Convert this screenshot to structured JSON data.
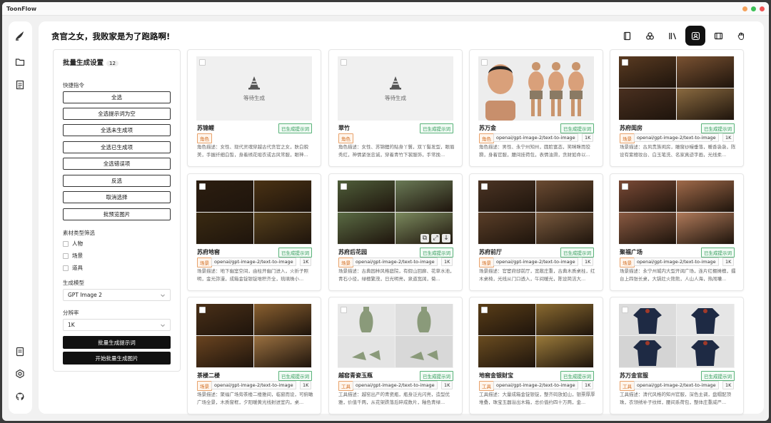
{
  "app": {
    "title": "ToonFlow"
  },
  "page": {
    "title": "贪官之女，我败家是为了跑路啊!"
  },
  "panel": {
    "title": "批量生成设置",
    "count": "12",
    "quick_label": "快捷指令",
    "quick_buttons": [
      "全选",
      "全选提示词为空",
      "全选未生成项",
      "全选已生成项",
      "全选错误项",
      "反选",
      "取消选择",
      "批预览图片"
    ],
    "filter_label": "素材类型筛选",
    "filters": [
      "人物",
      "场景",
      "道具"
    ],
    "model_label": "生成模型",
    "model_value": "GPT Image 2",
    "resolution_label": "分辨率",
    "resolution_value": "1K",
    "batch_prompt_btn": "批量生成提示词",
    "batch_image_btn": "开始批量生成图片"
  },
  "cards": [
    {
      "name": "苏锦鲤",
      "status": "已生成提示词",
      "type": "角色",
      "model": "",
      "size": "",
      "desc": "角色描述：女性、现代灵魂穿越古代贪官之女，肤白貌美，手握纤细白皙，身着绣花缎衣或古风常服，眼神...",
      "waiting": "等待生成"
    },
    {
      "name": "翠竹",
      "status": "已生成提示词",
      "type": "角色",
      "model": "",
      "size": "",
      "desc": "角色描述：女性、苏锦鲤的贴身丫鬟，双丫髻发型，眼眉秀红，神情紧张忠诚，穿着青竹下裳服饰，手常挽...",
      "waiting": "等待生成"
    },
    {
      "name": "苏万金",
      "status": "已生成提示词",
      "type": "角色",
      "model": "openai/gpt-image-2/text-to-image",
      "size": "1K",
      "desc": "角色描述：男性、永宁州知州，圆脸富态，笑眯眯而狡猾，身着官服，腰间挂荷包，表情油滑，贪财如命以...",
      "waiting": ""
    },
    {
      "name": "苏府闺房",
      "status": "已生成提示词",
      "type": "场景",
      "model": "openai/gpt-image-2/text-to-image",
      "size": "1K",
      "desc": "场景描述：古风贵族闺房，雕窗纱幔垂落，暖香袅袅，陈设有紫檀妆台、白玉笔洗、名家真迹字画，光线柔...",
      "waiting": ""
    },
    {
      "name": "苏府地窖",
      "status": "已生成提示词",
      "type": "场景",
      "model": "openai/gpt-image-2/text-to-image",
      "size": "1K",
      "desc": "场景描述：地下幽室空间，由柱开幽门进入，火折子照明，金光弥漫，成箱金锭银锭堆积齐全，琉璃珠小...",
      "waiting": ""
    },
    {
      "name": "苏府后花园",
      "status": "已生成提示词",
      "type": "场景",
      "model": "openai/gpt-image-2/text-to-image",
      "size": "1K",
      "desc": "场景描述：古典园林风格庭院，有假山回廊、花草水池，青石小径，绿檀繁茂，日光明亮，泉道宽阔，菊...",
      "waiting": ""
    },
    {
      "name": "苏府前厅",
      "status": "已生成提示词",
      "type": "场景",
      "model": "openai/gpt-image-2/text-to-image",
      "size": "1K",
      "desc": "场景描述：官宦府邸前厅，宽敞庄重，古典木质桌柱，红木桌椅，光线从门口透入，午间暖光，陈设简洁大...",
      "waiting": ""
    },
    {
      "name": "聚福广场",
      "status": "已生成提示词",
      "type": "场景",
      "model": "openai/gpt-image-2/text-to-image",
      "size": "1K",
      "desc": "场景描述：永宁州城内大型开阔广场，连片红棚摊檀，擂台上四张长桌，大锅灶火熊熊，人山人海，热闹嘈...",
      "waiting": ""
    },
    {
      "name": "茶楼二楼",
      "status": "已生成提示词",
      "type": "场景",
      "model": "openai/gpt-image-2/text-to-image",
      "size": "1K",
      "desc": "场景描述：聚福广场旁茶楼二楼雅间，临窗而设，可俯瞰广场全景，木质窗框，夕阳暖黄光线射进室内，桌...",
      "waiting": ""
    },
    {
      "name": "越窑青瓷玉瓶",
      "status": "已生成提示词",
      "type": "工具",
      "model": "openai/gpt-image-2/text-to-image",
      "size": "1K",
      "desc": "工具描述：越窑出产的青瓷瓶，瓶身泛光闪亮，造型优雅，价值千两，从花架跌落后碎成数片，釉色青绿...",
      "waiting": ""
    },
    {
      "name": "地窖金银财宝",
      "status": "已生成提示词",
      "type": "工具",
      "model": "openai/gpt-image-2/text-to-image",
      "size": "1K",
      "desc": "工具描述：大量成箱金锭银锭，整齐码放如山，银票厚厚堆叠，珠宝玉器溢出木箱，总价值约四十万两，金...",
      "waiting": ""
    },
    {
      "name": "苏万金官服",
      "status": "已生成提示词",
      "type": "工具",
      "model": "openai/gpt-image-2/text-to-image",
      "size": "1K",
      "desc": "工具描述：清代风格的知州官服，深色主调，盘帽配顶珠，衣领绣补子纹样，腰间系荷包，整体庄重威严...",
      "waiting": ""
    }
  ],
  "colors": {
    "accent": "#111111",
    "status_green": "#2f9a58",
    "tag_orange": "#d26f24"
  }
}
